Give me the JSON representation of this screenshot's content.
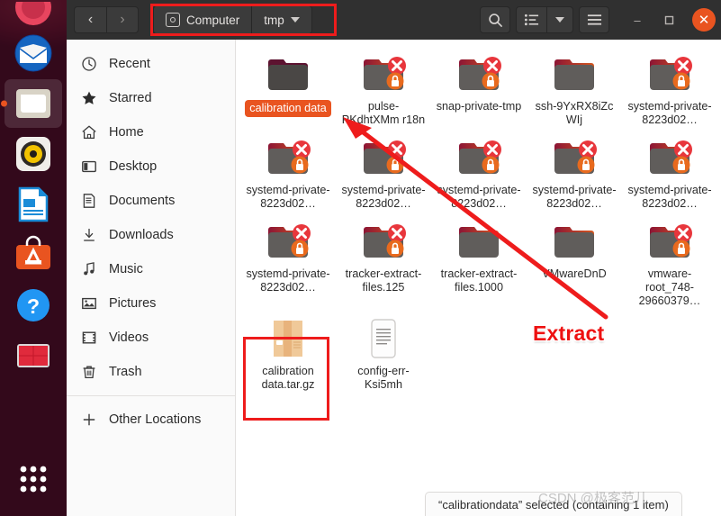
{
  "window": {
    "nav": {
      "back_label": "‹",
      "forward_label": "›"
    },
    "breadcrumbs": [
      {
        "label": "Computer",
        "icon": "disk-icon"
      },
      {
        "label": "tmp",
        "icon": "chevron-down-icon"
      }
    ],
    "toolbar": {
      "search_icon": "search-icon",
      "view_list_icon": "list-view-icon",
      "view_dropdown_icon": "chevron-down-icon",
      "menu_icon": "hamburger-menu-icon",
      "minimize_label": "–",
      "maximize_label": "❑",
      "close_label": "✕"
    }
  },
  "sidebar": {
    "items": [
      {
        "label": "Recent",
        "icon": "clock-icon"
      },
      {
        "label": "Starred",
        "icon": "star-icon"
      },
      {
        "label": "Home",
        "icon": "home-icon"
      },
      {
        "label": "Desktop",
        "icon": "desktop-icon"
      },
      {
        "label": "Documents",
        "icon": "document-icon"
      },
      {
        "label": "Downloads",
        "icon": "download-icon"
      },
      {
        "label": "Music",
        "icon": "music-note-icon"
      },
      {
        "label": "Pictures",
        "icon": "picture-icon"
      },
      {
        "label": "Videos",
        "icon": "video-icon"
      },
      {
        "label": "Trash",
        "icon": "trash-icon"
      }
    ],
    "other_locations": {
      "label": "Other Locations",
      "icon": "plus-icon"
    }
  },
  "files": [
    {
      "name": "calibrationdata",
      "label": "calibration data",
      "type": "folder",
      "selected": true,
      "locked": false,
      "blocked": false
    },
    {
      "name": "pulse-PKdhtXMmr18n",
      "label": "pulse-PKdhtXMm r18n",
      "type": "folder",
      "selected": false,
      "locked": true,
      "blocked": true
    },
    {
      "name": "snap-private-tmp",
      "label": "snap-private-tmp",
      "type": "folder",
      "selected": false,
      "locked": true,
      "blocked": true
    },
    {
      "name": "ssh-9YxRX8iZcWIj",
      "label": "ssh-9YxRX8iZc WIj",
      "type": "folder",
      "selected": false,
      "locked": false,
      "blocked": false
    },
    {
      "name": "systemd-private-8223d02-1",
      "label": "systemd-private-8223d02…",
      "type": "folder",
      "selected": false,
      "locked": true,
      "blocked": true
    },
    {
      "name": "systemd-private-8223d02-2",
      "label": "systemd-private-8223d02…",
      "type": "folder",
      "selected": false,
      "locked": true,
      "blocked": true
    },
    {
      "name": "systemd-private-8223d02-3",
      "label": "systemd-private-8223d02…",
      "type": "folder",
      "selected": false,
      "locked": true,
      "blocked": true
    },
    {
      "name": "systemd-private-8223d02-4",
      "label": "systemd-private-8223d02…",
      "type": "folder",
      "selected": false,
      "locked": true,
      "blocked": true
    },
    {
      "name": "systemd-private-8223d02-5",
      "label": "systemd-private-8223d02…",
      "type": "folder",
      "selected": false,
      "locked": true,
      "blocked": true
    },
    {
      "name": "systemd-private-8223d02-6",
      "label": "systemd-private-8223d02…",
      "type": "folder",
      "selected": false,
      "locked": true,
      "blocked": true
    },
    {
      "name": "systemd-private-8223d02-7",
      "label": "systemd-private-8223d02…",
      "type": "folder",
      "selected": false,
      "locked": true,
      "blocked": true
    },
    {
      "name": "tracker-extract-files.125",
      "label": "tracker-extract-files.125",
      "type": "folder",
      "selected": false,
      "locked": true,
      "blocked": true
    },
    {
      "name": "tracker-extract-files.1000",
      "label": "tracker-extract-files.1000",
      "type": "folder",
      "selected": false,
      "locked": false,
      "blocked": false
    },
    {
      "name": "VMwareDnD",
      "label": "VMwareDnD",
      "type": "folder",
      "selected": false,
      "locked": false,
      "blocked": false
    },
    {
      "name": "vmware-root_748-29660379",
      "label": "vmware-root_748-29660379…",
      "type": "folder",
      "selected": false,
      "locked": true,
      "blocked": true
    },
    {
      "name": "calibrationdata.tar.gz",
      "label": "calibration data.tar.gz",
      "type": "archive",
      "selected": false,
      "locked": false,
      "blocked": false
    },
    {
      "name": "config-err-Ksi5mh",
      "label": "config-err-Ksi5mh",
      "type": "text",
      "selected": false,
      "locked": false,
      "blocked": false
    }
  ],
  "statusbar": {
    "text": "“calibrationdata” selected (containing 1 item)"
  },
  "annotations": {
    "extract_label": "Extract",
    "box_color": "#ee1c1c",
    "arrow_color": "#ee1c1c"
  },
  "watermark": {
    "text": "CSDN @极客范儿"
  },
  "dock": {
    "items": [
      {
        "name": "firefox",
        "label": "Firefox"
      },
      {
        "name": "thunderbird",
        "label": "Thunderbird Mail"
      },
      {
        "name": "files",
        "label": "Files"
      },
      {
        "name": "rhythmbox",
        "label": "Rhythmbox"
      },
      {
        "name": "libreoffice",
        "label": "LibreOffice Writer"
      },
      {
        "name": "ubuntu-software",
        "label": "Ubuntu Software"
      },
      {
        "name": "help",
        "label": "Help"
      },
      {
        "name": "red-app",
        "label": "Application"
      },
      {
        "name": "show-apps",
        "label": "Show Applications"
      }
    ]
  },
  "colors": {
    "accent": "#e95420",
    "header_bg": "#303030",
    "annotation_red": "#ee1c1c"
  }
}
